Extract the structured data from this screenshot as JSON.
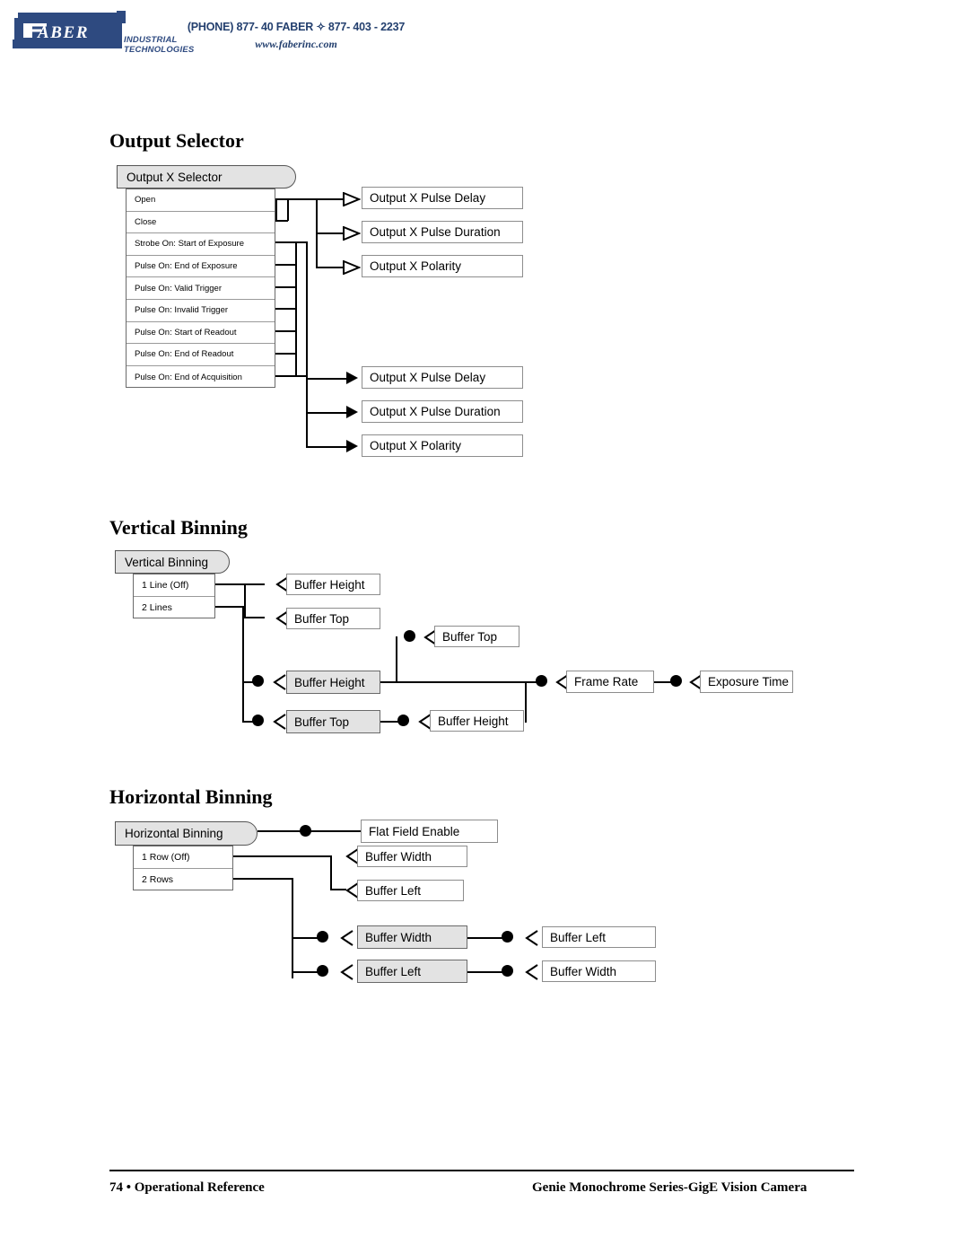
{
  "header": {
    "logo_text": "FABER",
    "logo_line1": "INDUSTRIAL",
    "logo_line2": "TECHNOLOGIES",
    "phone": "(PHONE) 877- 40 FABER ✧ 877- 403 - 2237",
    "website": "www.faberinc.com",
    "brand_color": "#2e4a80"
  },
  "sections": {
    "output_selector": {
      "heading": "Output Selector",
      "pill_label": "Output X Selector",
      "options": [
        "Open",
        "Close",
        "Strobe On: Start of Exposure",
        "Pulse On: End of Exposure",
        "Pulse On: Valid Trigger",
        "Pulse On: Invalid Trigger",
        "Pulse On: Start of Readout",
        "Pulse On: End of Readout",
        "Pulse On: End of Acquisition"
      ],
      "group_top": [
        "Output X Pulse Delay",
        "Output X Pulse Duration",
        "Output X Polarity"
      ],
      "group_bottom": [
        "Output X Pulse Delay",
        "Output X Pulse Duration",
        "Output X Polarity"
      ]
    },
    "vertical_binning": {
      "heading": "Vertical Binning",
      "pill_label": "Vertical Binning",
      "options": [
        "1 Line (Off)",
        "2 Lines"
      ],
      "nodes": {
        "off_buffer_height": "Buffer Height",
        "off_buffer_top": "Buffer Top",
        "on_buffer_height": "Buffer Height",
        "on_buffer_top": "Buffer Top",
        "chain_buffer_top": "Buffer Top",
        "chain_buffer_height": "Buffer Height",
        "frame_rate": "Frame Rate",
        "exposure_time": "Exposure Time"
      }
    },
    "horizontal_binning": {
      "heading": "Horizontal Binning",
      "pill_label": "Horizontal Binning",
      "options": [
        "1 Row (Off)",
        "2 Rows"
      ],
      "nodes": {
        "flat_field_enable": "Flat Field Enable",
        "off_buffer_width": "Buffer Width",
        "off_buffer_left": "Buffer Left",
        "on_buffer_width": "Buffer Width",
        "on_buffer_left": "Buffer Left",
        "chain_buffer_left": "Buffer Left",
        "chain_buffer_width": "Buffer Width"
      }
    }
  },
  "footer": {
    "left": "74 • Operational Reference",
    "right": "Genie Monochrome Series-GigE Vision Camera"
  }
}
